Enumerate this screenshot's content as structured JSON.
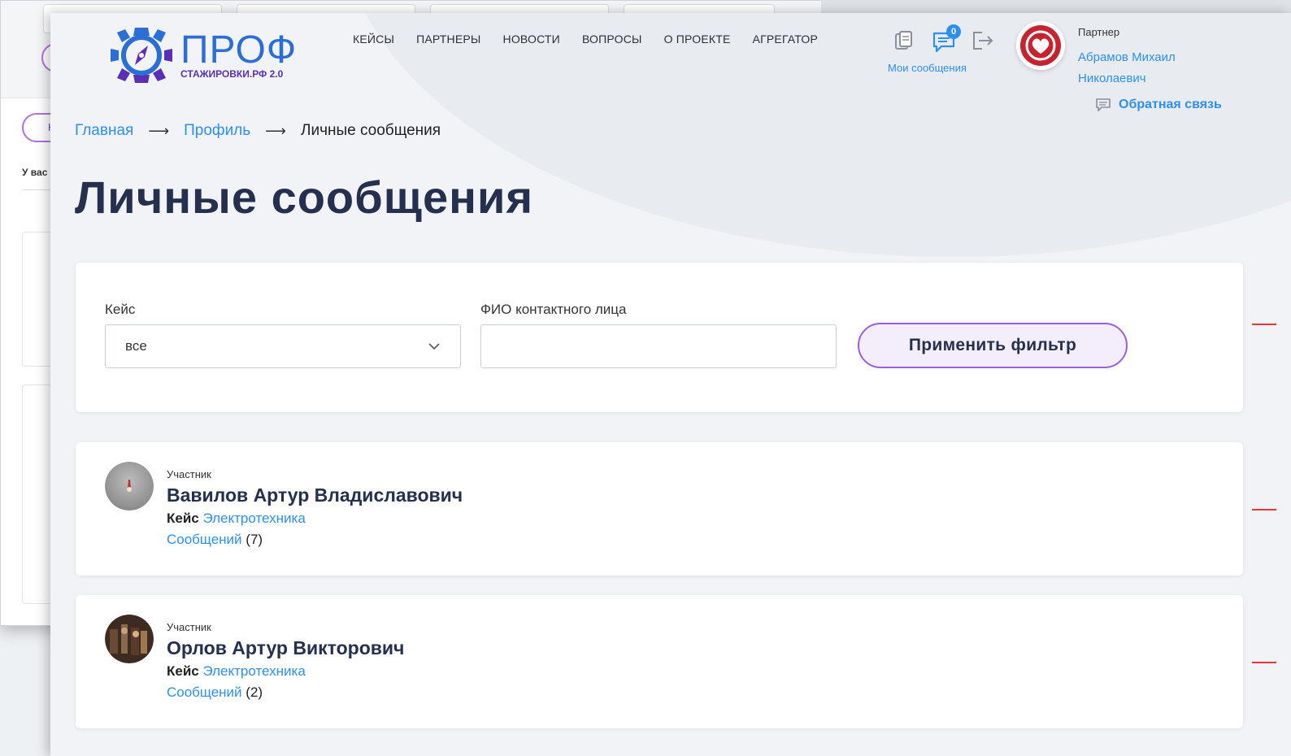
{
  "logo": {
    "title": "ПРОФ",
    "subtitle": "СТАЖИРОВКИ.РФ 2.0"
  },
  "nav": [
    "КЕЙСЫ",
    "ПАРТНЕРЫ",
    "НОВОСТИ",
    "ВОПРОСЫ",
    "О ПРОЕКТЕ",
    "АГРЕГАТОР"
  ],
  "header": {
    "messages_badge": "0",
    "my_messages": "Мои сообщения",
    "role": "Партнер",
    "user_name": "Абрамов Михаил Николаевич",
    "feedback": "Обратная связь"
  },
  "breadcrumb": {
    "home": "Главная",
    "profile": "Профиль",
    "current": "Личные сообщения"
  },
  "page_title": "Личные сообщения",
  "filter": {
    "case_label": "Кейс",
    "case_value": "все",
    "contact_label": "ФИО контактного лица",
    "contact_value": "",
    "apply_label": "Применить фильтр"
  },
  "contacts": [
    {
      "role": "Участник",
      "name": "Вавилов Артур Владиславович",
      "case_label": "Кейс",
      "case": "Электротехника",
      "messages_label": "Сообщений",
      "messages_count": "(7)"
    },
    {
      "role": "Участник",
      "name": "Орлов Артур Викторович",
      "case_label": "Кейс",
      "case": "Электротехника",
      "messages_label": "Сообщений",
      "messages_count": "(2)"
    }
  ],
  "background_window": {
    "label": "У вас",
    "pill_text": "Н"
  },
  "colors": {
    "accent": "#2d8ff0",
    "button_border": "#9b5de5",
    "title": "#25304f",
    "logo_blue": "#2b6fd6",
    "logo_purple": "#5a2fb6"
  }
}
